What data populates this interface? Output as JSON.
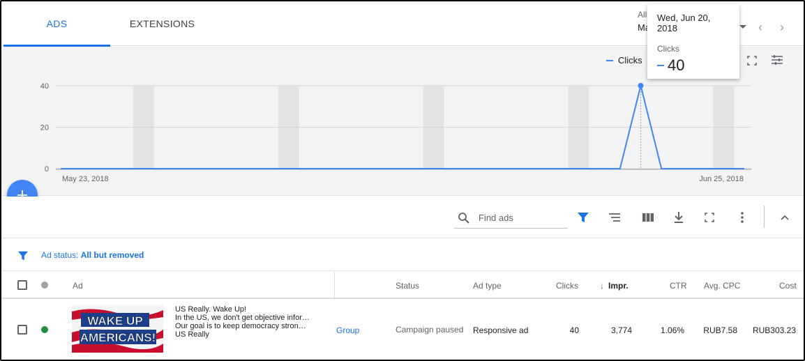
{
  "tabs": [
    {
      "label": "ADS",
      "active": true
    },
    {
      "label": "EXTENSIONS",
      "active": false
    }
  ],
  "date_range": {
    "label": "All",
    "value": "Ma"
  },
  "chart": {
    "legend_label": "Clicks",
    "tooltip": {
      "date": "Wed, Jun 20, 2018",
      "metric": "Clicks",
      "value": "40"
    }
  },
  "chart_data": {
    "type": "line",
    "series": [
      {
        "name": "Clicks",
        "color": "#4285f4",
        "x": [
          "2018-05-23",
          "2018-05-24",
          "2018-05-25",
          "2018-05-26",
          "2018-05-27",
          "2018-05-28",
          "2018-05-29",
          "2018-05-30",
          "2018-05-31",
          "2018-06-01",
          "2018-06-02",
          "2018-06-03",
          "2018-06-04",
          "2018-06-05",
          "2018-06-06",
          "2018-06-07",
          "2018-06-08",
          "2018-06-09",
          "2018-06-10",
          "2018-06-11",
          "2018-06-12",
          "2018-06-13",
          "2018-06-14",
          "2018-06-15",
          "2018-06-16",
          "2018-06-17",
          "2018-06-18",
          "2018-06-19",
          "2018-06-20",
          "2018-06-21",
          "2018-06-22",
          "2018-06-23",
          "2018-06-24",
          "2018-06-25"
        ],
        "values": [
          0,
          0,
          0,
          0,
          0,
          0,
          0,
          0,
          0,
          0,
          0,
          0,
          0,
          0,
          0,
          0,
          0,
          0,
          0,
          0,
          0,
          0,
          0,
          0,
          0,
          0,
          0,
          0,
          40,
          0,
          0,
          0,
          0,
          0
        ]
      }
    ],
    "yticks": [
      "40",
      "20",
      "0"
    ],
    "ylim": [
      0,
      40
    ],
    "x_tick_labels": [
      "May 23, 2018",
      "Jun 25, 2018"
    ],
    "weekend_bands": true,
    "grid": true,
    "legend_position": "top-right"
  },
  "toolbar": {
    "search_placeholder": "Find ads"
  },
  "filter": {
    "prefix": "Ad status: ",
    "value": "All but removed"
  },
  "table": {
    "columns": {
      "ad": "Ad",
      "status": "Status",
      "ad_type": "Ad type",
      "clicks": "Clicks",
      "impr": "Impr.",
      "ctr": "CTR",
      "avg_cpc": "Avg. CPC",
      "cost": "Cost"
    },
    "rows": [
      {
        "status_dot_color": "#1e8e3e",
        "ad_image_text": [
          "WAKE UP",
          "AMERICANS!"
        ],
        "ad_lines": [
          "US Really. Wake Up!",
          "In the US, we don't get objective infor…",
          "Our goal is to keep democracy stron…",
          "US Really"
        ],
        "ad_group": "Group",
        "status": "Campaign paused",
        "ad_type": "Responsive ad",
        "clicks": "40",
        "impr": "3,774",
        "ctr": "1.06%",
        "avg_cpc": "RUB7.58",
        "cost": "RUB303.23"
      }
    ]
  }
}
